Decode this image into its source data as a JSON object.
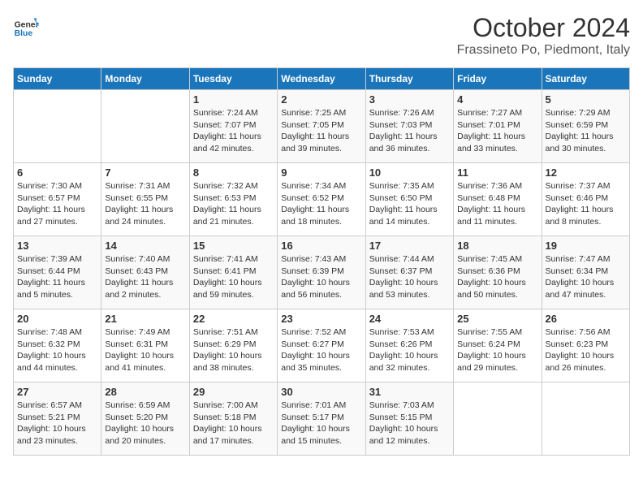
{
  "header": {
    "logo_general": "General",
    "logo_blue": "Blue",
    "month": "October 2024",
    "location": "Frassineto Po, Piedmont, Italy"
  },
  "weekdays": [
    "Sunday",
    "Monday",
    "Tuesday",
    "Wednesday",
    "Thursday",
    "Friday",
    "Saturday"
  ],
  "weeks": [
    [
      {
        "day": "",
        "sunrise": "",
        "sunset": "",
        "daylight": ""
      },
      {
        "day": "",
        "sunrise": "",
        "sunset": "",
        "daylight": ""
      },
      {
        "day": "1",
        "sunrise": "Sunrise: 7:24 AM",
        "sunset": "Sunset: 7:07 PM",
        "daylight": "Daylight: 11 hours and 42 minutes."
      },
      {
        "day": "2",
        "sunrise": "Sunrise: 7:25 AM",
        "sunset": "Sunset: 7:05 PM",
        "daylight": "Daylight: 11 hours and 39 minutes."
      },
      {
        "day": "3",
        "sunrise": "Sunrise: 7:26 AM",
        "sunset": "Sunset: 7:03 PM",
        "daylight": "Daylight: 11 hours and 36 minutes."
      },
      {
        "day": "4",
        "sunrise": "Sunrise: 7:27 AM",
        "sunset": "Sunset: 7:01 PM",
        "daylight": "Daylight: 11 hours and 33 minutes."
      },
      {
        "day": "5",
        "sunrise": "Sunrise: 7:29 AM",
        "sunset": "Sunset: 6:59 PM",
        "daylight": "Daylight: 11 hours and 30 minutes."
      }
    ],
    [
      {
        "day": "6",
        "sunrise": "Sunrise: 7:30 AM",
        "sunset": "Sunset: 6:57 PM",
        "daylight": "Daylight: 11 hours and 27 minutes."
      },
      {
        "day": "7",
        "sunrise": "Sunrise: 7:31 AM",
        "sunset": "Sunset: 6:55 PM",
        "daylight": "Daylight: 11 hours and 24 minutes."
      },
      {
        "day": "8",
        "sunrise": "Sunrise: 7:32 AM",
        "sunset": "Sunset: 6:53 PM",
        "daylight": "Daylight: 11 hours and 21 minutes."
      },
      {
        "day": "9",
        "sunrise": "Sunrise: 7:34 AM",
        "sunset": "Sunset: 6:52 PM",
        "daylight": "Daylight: 11 hours and 18 minutes."
      },
      {
        "day": "10",
        "sunrise": "Sunrise: 7:35 AM",
        "sunset": "Sunset: 6:50 PM",
        "daylight": "Daylight: 11 hours and 14 minutes."
      },
      {
        "day": "11",
        "sunrise": "Sunrise: 7:36 AM",
        "sunset": "Sunset: 6:48 PM",
        "daylight": "Daylight: 11 hours and 11 minutes."
      },
      {
        "day": "12",
        "sunrise": "Sunrise: 7:37 AM",
        "sunset": "Sunset: 6:46 PM",
        "daylight": "Daylight: 11 hours and 8 minutes."
      }
    ],
    [
      {
        "day": "13",
        "sunrise": "Sunrise: 7:39 AM",
        "sunset": "Sunset: 6:44 PM",
        "daylight": "Daylight: 11 hours and 5 minutes."
      },
      {
        "day": "14",
        "sunrise": "Sunrise: 7:40 AM",
        "sunset": "Sunset: 6:43 PM",
        "daylight": "Daylight: 11 hours and 2 minutes."
      },
      {
        "day": "15",
        "sunrise": "Sunrise: 7:41 AM",
        "sunset": "Sunset: 6:41 PM",
        "daylight": "Daylight: 10 hours and 59 minutes."
      },
      {
        "day": "16",
        "sunrise": "Sunrise: 7:43 AM",
        "sunset": "Sunset: 6:39 PM",
        "daylight": "Daylight: 10 hours and 56 minutes."
      },
      {
        "day": "17",
        "sunrise": "Sunrise: 7:44 AM",
        "sunset": "Sunset: 6:37 PM",
        "daylight": "Daylight: 10 hours and 53 minutes."
      },
      {
        "day": "18",
        "sunrise": "Sunrise: 7:45 AM",
        "sunset": "Sunset: 6:36 PM",
        "daylight": "Daylight: 10 hours and 50 minutes."
      },
      {
        "day": "19",
        "sunrise": "Sunrise: 7:47 AM",
        "sunset": "Sunset: 6:34 PM",
        "daylight": "Daylight: 10 hours and 47 minutes."
      }
    ],
    [
      {
        "day": "20",
        "sunrise": "Sunrise: 7:48 AM",
        "sunset": "Sunset: 6:32 PM",
        "daylight": "Daylight: 10 hours and 44 minutes."
      },
      {
        "day": "21",
        "sunrise": "Sunrise: 7:49 AM",
        "sunset": "Sunset: 6:31 PM",
        "daylight": "Daylight: 10 hours and 41 minutes."
      },
      {
        "day": "22",
        "sunrise": "Sunrise: 7:51 AM",
        "sunset": "Sunset: 6:29 PM",
        "daylight": "Daylight: 10 hours and 38 minutes."
      },
      {
        "day": "23",
        "sunrise": "Sunrise: 7:52 AM",
        "sunset": "Sunset: 6:27 PM",
        "daylight": "Daylight: 10 hours and 35 minutes."
      },
      {
        "day": "24",
        "sunrise": "Sunrise: 7:53 AM",
        "sunset": "Sunset: 6:26 PM",
        "daylight": "Daylight: 10 hours and 32 minutes."
      },
      {
        "day": "25",
        "sunrise": "Sunrise: 7:55 AM",
        "sunset": "Sunset: 6:24 PM",
        "daylight": "Daylight: 10 hours and 29 minutes."
      },
      {
        "day": "26",
        "sunrise": "Sunrise: 7:56 AM",
        "sunset": "Sunset: 6:23 PM",
        "daylight": "Daylight: 10 hours and 26 minutes."
      }
    ],
    [
      {
        "day": "27",
        "sunrise": "Sunrise: 6:57 AM",
        "sunset": "Sunset: 5:21 PM",
        "daylight": "Daylight: 10 hours and 23 minutes."
      },
      {
        "day": "28",
        "sunrise": "Sunrise: 6:59 AM",
        "sunset": "Sunset: 5:20 PM",
        "daylight": "Daylight: 10 hours and 20 minutes."
      },
      {
        "day": "29",
        "sunrise": "Sunrise: 7:00 AM",
        "sunset": "Sunset: 5:18 PM",
        "daylight": "Daylight: 10 hours and 17 minutes."
      },
      {
        "day": "30",
        "sunrise": "Sunrise: 7:01 AM",
        "sunset": "Sunset: 5:17 PM",
        "daylight": "Daylight: 10 hours and 15 minutes."
      },
      {
        "day": "31",
        "sunrise": "Sunrise: 7:03 AM",
        "sunset": "Sunset: 5:15 PM",
        "daylight": "Daylight: 10 hours and 12 minutes."
      },
      {
        "day": "",
        "sunrise": "",
        "sunset": "",
        "daylight": ""
      },
      {
        "day": "",
        "sunrise": "",
        "sunset": "",
        "daylight": ""
      }
    ]
  ]
}
